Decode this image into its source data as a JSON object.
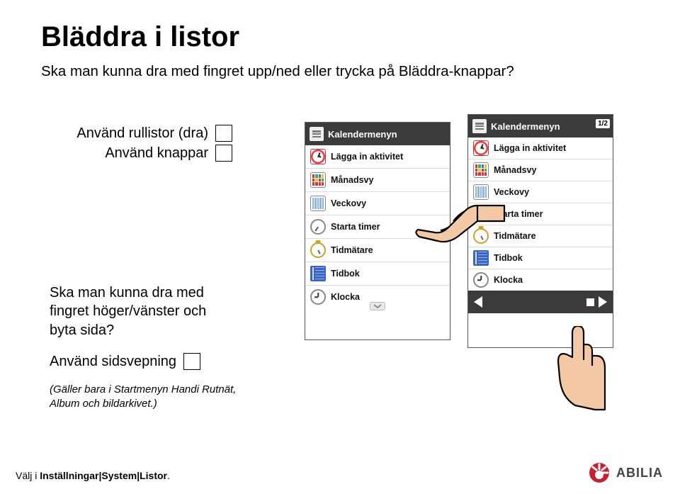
{
  "title": "Bläddra i listor",
  "subtitle": "Ska man kunna dra med fingret upp/ned eller trycka på Bläddra-knappar?",
  "options": {
    "rullistor": "Använd rullistor (dra)",
    "knappar": "Använd knappar"
  },
  "question2": "Ska man kunna dra med fingret höger/vänster och byta sida?",
  "option3": "Använd sidsvepning",
  "note": "(Gäller bara i Startmenyn Handi Rutnät, Album och bildarkivet.)",
  "footer_pre": "Välj i ",
  "footer_path": "Inställningar|System|Listor",
  "footer_suffix": ".",
  "phone_header": "Kalendermenyn",
  "page_badge": "1/2",
  "items": [
    "Lägga in aktivitet",
    "Månadsvy",
    "Veckovy",
    "Starta timer",
    "Tidmätare",
    "Tidbok",
    "Klocka"
  ],
  "brand": "ABILIA"
}
